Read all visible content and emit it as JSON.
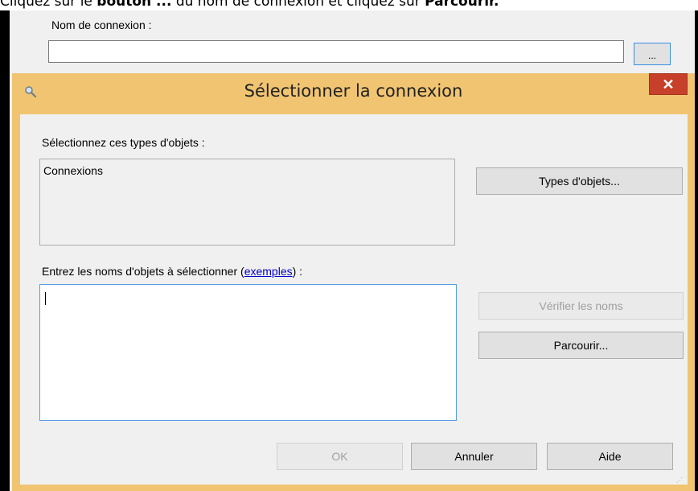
{
  "instruction": {
    "pre": "Cliquez sur le ",
    "bold1": "bouton ...",
    "mid": " du nom de connexion et cliquez sur ",
    "bold2": "Parcourir."
  },
  "background_window": {
    "label": "Nom de connexion :",
    "input_value": "",
    "browse_label": "..."
  },
  "dialog": {
    "title": "Sélectionner la connexion",
    "close_label": "✕",
    "object_types_label": "Sélectionnez ces types d'objets :",
    "object_types_value": "Connexions",
    "object_types_button": "Types d'objets...",
    "names_label_pre": "Entrez les noms d'objets à sélectionner (",
    "names_label_link": "exemples",
    "names_label_post": ") :",
    "names_value": "",
    "check_names_button": "Vérifier les noms",
    "browse_button": "Parcourir...",
    "ok_button": "OK",
    "cancel_button": "Annuler",
    "help_button": "Aide"
  },
  "colors": {
    "dialog_frame": "#f0c471",
    "close_button": "#c7402b",
    "focus_border": "#569de5",
    "link": "#0000cc"
  }
}
